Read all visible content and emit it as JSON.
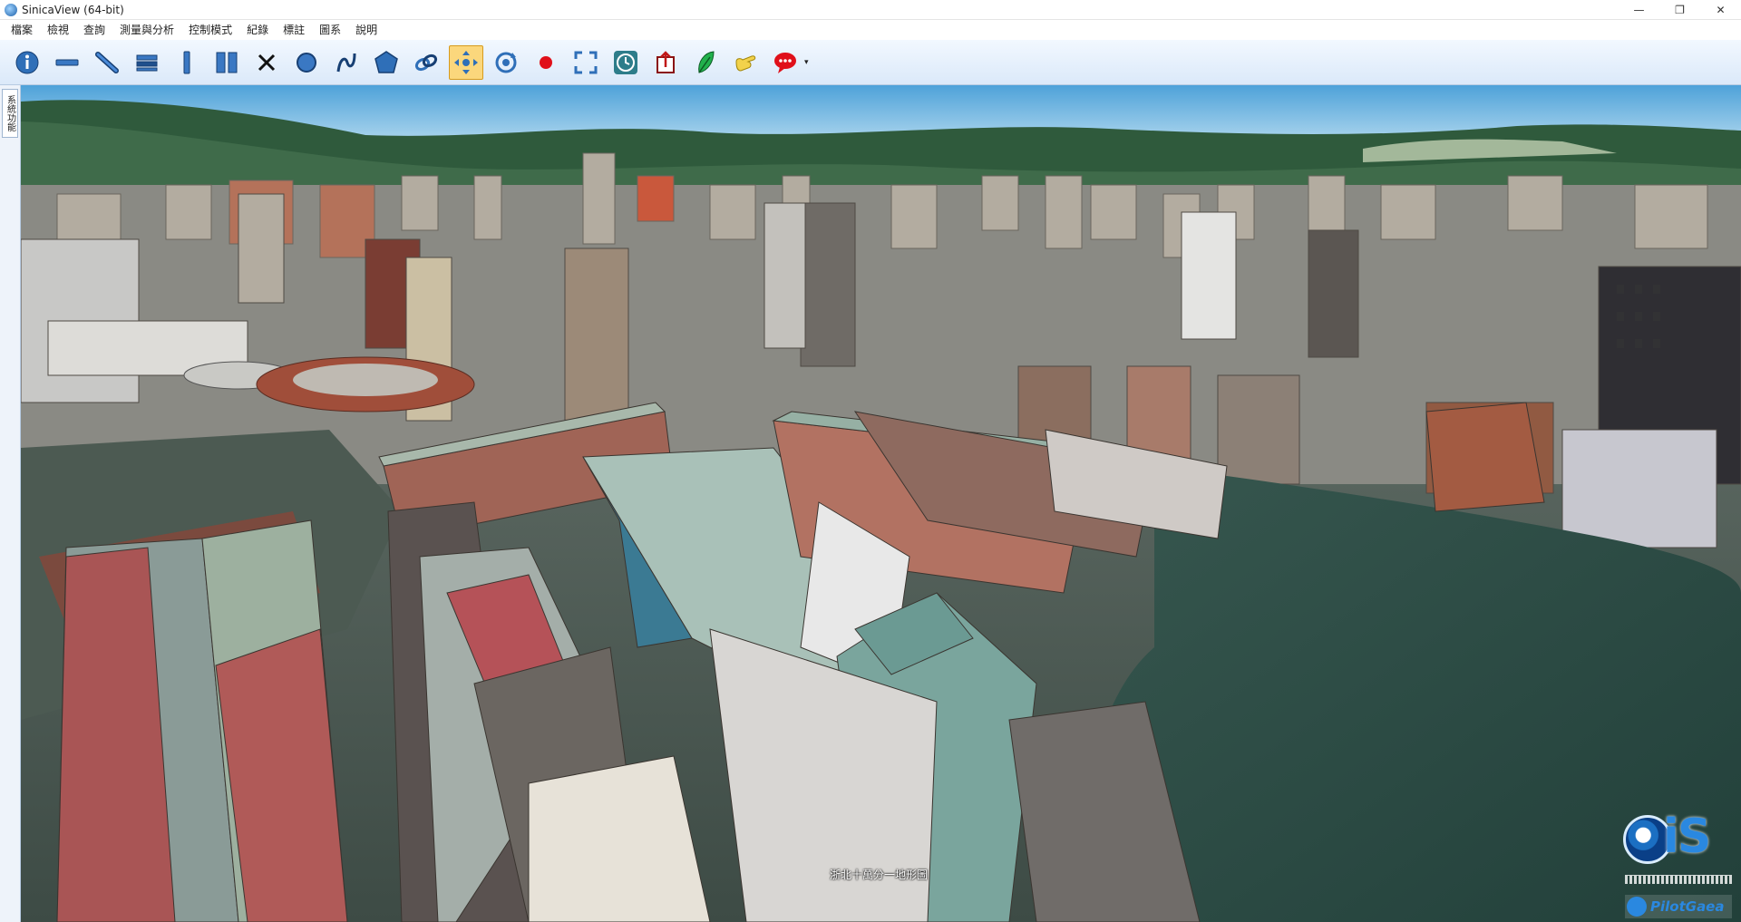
{
  "window": {
    "title": "SinicaView (64-bit)",
    "controls": {
      "minimize": "—",
      "restore": "❐",
      "close": "✕"
    }
  },
  "menu": [
    "檔案",
    "檢視",
    "查詢",
    "測量與分析",
    "控制模式",
    "紀錄",
    "標註",
    "圖系",
    "說明"
  ],
  "toolbar": {
    "buttons": [
      {
        "name": "info-button",
        "icon": "info-icon"
      },
      {
        "name": "measure-horizontal-button",
        "icon": "horizontal-line-icon"
      },
      {
        "name": "measure-line-button",
        "icon": "diagonal-line-icon"
      },
      {
        "name": "profile-button",
        "icon": "stack-icon"
      },
      {
        "name": "measure-vertical-button",
        "icon": "vertical-line-icon"
      },
      {
        "name": "columns-button",
        "icon": "columns-icon"
      },
      {
        "name": "clear-button",
        "icon": "close-icon"
      },
      {
        "name": "circle-button",
        "icon": "circle-icon"
      },
      {
        "name": "curve-button",
        "icon": "curve-icon"
      },
      {
        "name": "polygon-button",
        "icon": "polygon-icon"
      },
      {
        "name": "link-button",
        "icon": "link-icon"
      },
      {
        "name": "pan-button",
        "icon": "move-icon",
        "active": true
      },
      {
        "name": "rotate-button",
        "icon": "rotate-icon"
      },
      {
        "name": "record-button",
        "icon": "record-icon"
      },
      {
        "name": "fullscreen-button",
        "icon": "fullscreen-icon"
      },
      {
        "name": "history-button",
        "icon": "clock-icon"
      },
      {
        "name": "export-button",
        "icon": "export-icon"
      },
      {
        "name": "feather-button",
        "icon": "feather-icon"
      },
      {
        "name": "hand-button",
        "icon": "hand-icon"
      },
      {
        "name": "comment-button",
        "icon": "speech-bubble-icon"
      }
    ]
  },
  "sidebar": {
    "tab_label": "系統功能"
  },
  "map": {
    "caption": "浙北十萬分一地形圖"
  },
  "logo": {
    "mark": "iS",
    "brand": "PilotGaea"
  },
  "colors": {
    "toolbar_bg": "#dbe9f9",
    "active_button": "#fbd77c",
    "accent": "#2a88e0"
  }
}
